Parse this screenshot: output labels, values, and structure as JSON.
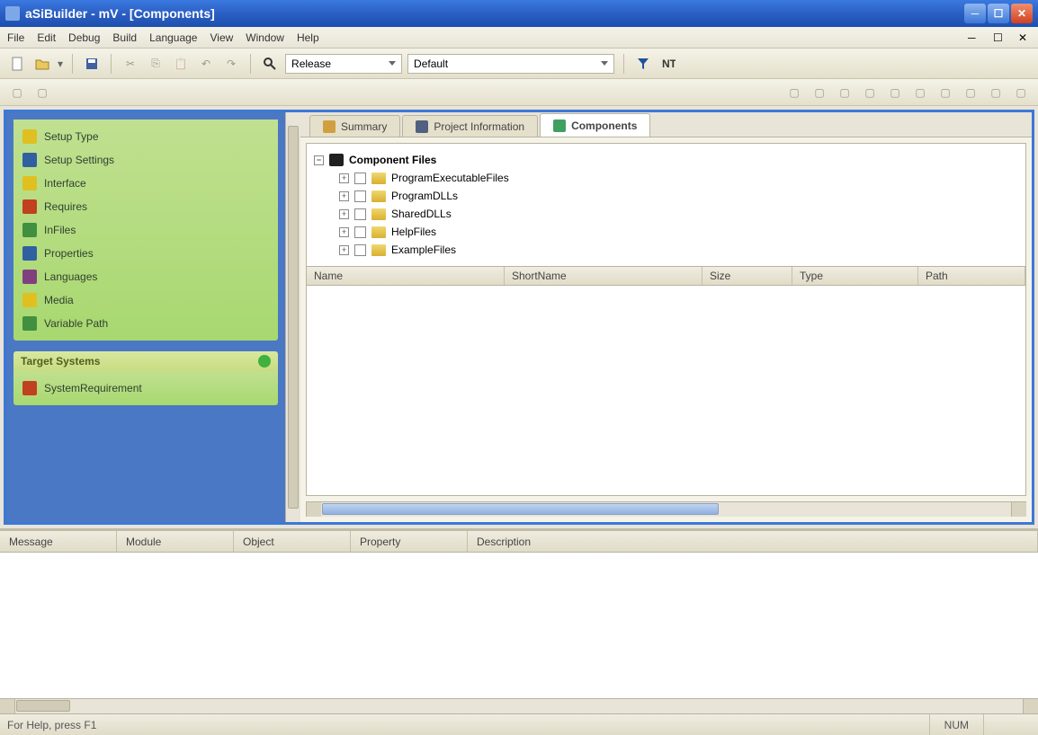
{
  "window": {
    "title": "aSiBuilder - mV - [Components]"
  },
  "menubar": [
    "File",
    "Edit",
    "Debug",
    "Build",
    "Language",
    "View",
    "Window",
    "Help"
  ],
  "toolbar": {
    "combo1": "Release",
    "combo2": "Default"
  },
  "sidebar": {
    "panel1_title": "",
    "items": [
      "Setup Type",
      "Setup Settings",
      "Interface",
      "Requires",
      "InFiles",
      "Properties",
      "Languages",
      "Media",
      "Variable Path"
    ],
    "panel2_title": "Target Systems",
    "panel2_items": [
      "SystemRequirement"
    ]
  },
  "tabs": {
    "t1": "Summary",
    "t2": "Project Information",
    "t3": "Components"
  },
  "tree": {
    "root": "Component Files",
    "children": [
      "ProgramExecutableFiles",
      "ProgramDLLs",
      "SharedDLLs",
      "HelpFiles",
      "ExampleFiles"
    ]
  },
  "grid_cols": [
    "Name",
    "ShortName",
    "Size",
    "Type",
    "Path"
  ],
  "output_cols": [
    "Message",
    "Module",
    "Object",
    "Property",
    "Description"
  ],
  "statusbar": {
    "hint": "For Help, press F1",
    "pane1": "NUM"
  }
}
